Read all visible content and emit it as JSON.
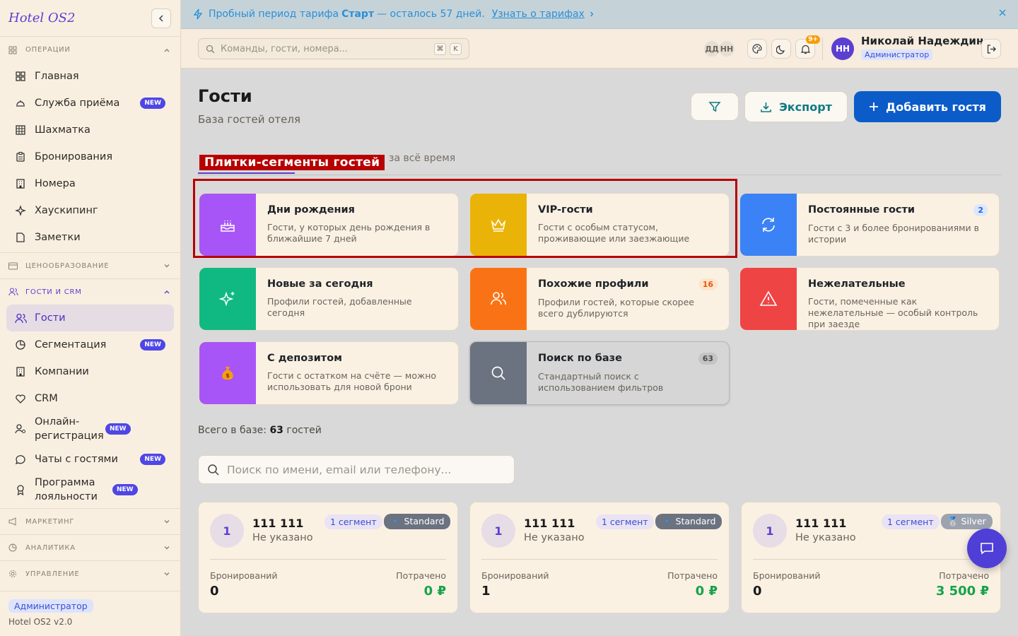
{
  "app": {
    "name": "Hotel OS2",
    "version": "Hotel OS2 v2.0",
    "role": "Администратор"
  },
  "sidebar": {
    "sections": [
      {
        "title": "ОПЕРАЦИИ",
        "items": [
          {
            "label": "Главная"
          },
          {
            "label": "Служба приёма",
            "badge": "NEW"
          },
          {
            "label": "Шахматка"
          },
          {
            "label": "Бронирования"
          },
          {
            "label": "Номера"
          },
          {
            "label": "Хаускипинг"
          },
          {
            "label": "Заметки"
          }
        ]
      },
      {
        "title": "ЦЕНООБРАЗОВАНИЕ"
      },
      {
        "title": "ГОСТИ И CRM",
        "items": [
          {
            "label": "Гости"
          },
          {
            "label": "Сегментация",
            "badge": "NEW"
          },
          {
            "label": "Компании"
          },
          {
            "label": "CRM"
          },
          {
            "label": "Онлайн-регистрация",
            "badge": "NEW"
          },
          {
            "label": "Чаты с гостями",
            "badge": "NEW"
          },
          {
            "label": "Программа лояльности",
            "badge": "NEW"
          }
        ]
      },
      {
        "title": "МАРКЕТИНГ"
      },
      {
        "title": "АНАЛИТИКА"
      },
      {
        "title": "УПРАВЛЕНИЕ"
      }
    ]
  },
  "trial": {
    "prefix": "Пробный период тарифа",
    "plan": "Старт",
    "suffix": "— осталось 57 дней.",
    "link": "Узнать о тарифах"
  },
  "header": {
    "search_placeholder": "Команды, гости, номера...",
    "kbd1": "⌘",
    "kbd2": "K",
    "lang1": "ДД",
    "lang2": "НН",
    "notif_count": "9+",
    "user": {
      "initials": "НН",
      "name": "Николай Надеждин",
      "role": "Администратор"
    }
  },
  "page": {
    "title": "Гости",
    "subtitle": "База гостей отеля",
    "export_label": "Экспорт",
    "add_label": "Добавить гостя",
    "annotation": "Плитки-сегменты гостей",
    "tab_all_time": "за всё время",
    "total_prefix": "Всего в базе:",
    "total_count": "63",
    "total_suffix": "гостей",
    "guest_search_placeholder": "Поиск по имени, email или телефону..."
  },
  "tiles": [
    {
      "title": "Дни рождения",
      "desc": "Гости, у которых день рождения в ближайшие 7 дней",
      "color": "#a855f7",
      "icon": "cake-icon"
    },
    {
      "title": "VIP-гости",
      "desc": "Гости с особым статусом, проживающие или заезжающие",
      "color": "#eab308",
      "icon": "crown-icon"
    },
    {
      "title": "Постоянные гости",
      "desc": "Гости с 3 и более бронированиями в истории",
      "count": "2",
      "color": "#3b82f6",
      "icon": "refresh-icon"
    },
    {
      "title": "Новые за сегодня",
      "desc": "Профили гостей, добавленные сегодня",
      "color": "#10b981",
      "icon": "sparkles-icon"
    },
    {
      "title": "Похожие профили",
      "desc": "Профили гостей, которые скорее всего дублируются",
      "count": "16",
      "color": "#f97316",
      "icon": "users-icon"
    },
    {
      "title": "Нежелательные",
      "desc": "Гости, помеченные как нежелательные — особый контроль при заезде",
      "color": "#ef4444",
      "icon": "alert-icon"
    },
    {
      "title": "С депозитом",
      "desc": "Гости с остатком на счёте — можно использовать для новой брони",
      "color": "#a855f7",
      "icon": "money-bag-icon"
    },
    {
      "title": "Поиск по базе",
      "desc": "Стандартный поиск с использованием фильтров",
      "count": "63",
      "color": "#6b7280",
      "icon": "search-icon"
    }
  ],
  "guests": [
    {
      "initial": "1",
      "name": "111 111",
      "sub": "Не указано",
      "segments": "1 сегмент",
      "tier": "Standard",
      "tier_color": "#6b7280",
      "bookings_label": "Бронирований",
      "bookings": "0",
      "spent_label": "Потрачено",
      "spent": "0 ₽"
    },
    {
      "initial": "1",
      "name": "111 111",
      "sub": "Не указано",
      "segments": "1 сегмент",
      "tier": "Standard",
      "tier_color": "#6b7280",
      "bookings_label": "Бронирований",
      "bookings": "1",
      "spent_label": "Потрачено",
      "spent": "0 ₽"
    },
    {
      "initial": "1",
      "name": "111 111",
      "sub": "Не указано",
      "segments": "1 сегмент",
      "tier": "Silver",
      "tier_color": "#9ca3af",
      "bookings_label": "Бронирований",
      "bookings": "0",
      "spent_label": "Потрачено",
      "spent": "3 500 ₽"
    }
  ]
}
